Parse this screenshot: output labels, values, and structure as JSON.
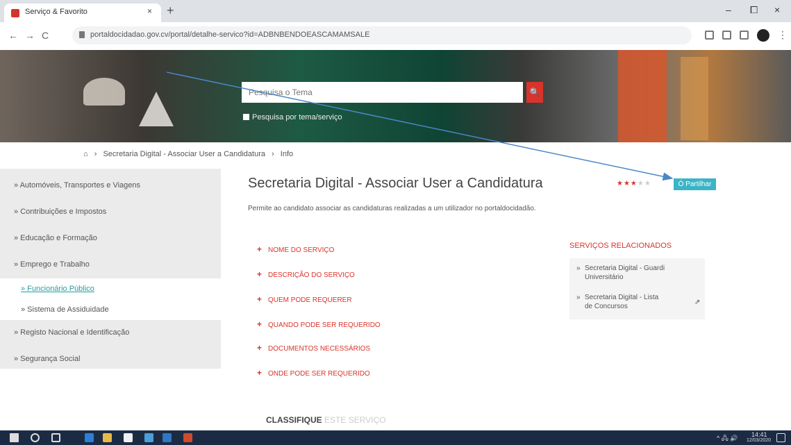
{
  "browser": {
    "tab_title": "Serviço & Favorito",
    "tab_close": "×",
    "new_tab": "+",
    "url": "portaldocidadao.gov.cv/portal/detalhe-servico?id=ADBNBENDOEASCAMAMSALE",
    "win_min": "–",
    "win_max": "⧠",
    "win_close": "×",
    "back": "←",
    "forward": "→",
    "reload": "C",
    "menu": "⋮"
  },
  "hero": {
    "search_placeholder": "Pesquisa o Tema",
    "search_button": "🔍",
    "checkbox_label": "Pesquisa por tema/serviço"
  },
  "breadcrumb": {
    "home": "⌂",
    "sep": "›",
    "crumb1": "Secretaria Digital - Associar User a Candidatura",
    "crumb2": "Info"
  },
  "sidebar": {
    "items": [
      {
        "label": "» Automóveis, Transportes e Viagens"
      },
      {
        "label": "» Contribuições e Impostos"
      },
      {
        "label": "» Educação e Formação"
      },
      {
        "label": "» Emprego e Trabalho"
      },
      {
        "label": "» Registo Nacional e Identificação"
      },
      {
        "label": "» Segurança Social"
      }
    ],
    "subitems": [
      {
        "label": "» Funcionário Público"
      },
      {
        "label": "» Sistema de Assiduidade"
      }
    ]
  },
  "main": {
    "title": "Secretaria Digital - Associar User a Candidatura",
    "stars_on": "★★★",
    "stars_off": "★★",
    "pill": "Ó Partilhar",
    "description": "Permite ao candidato associar as candidaturas realizadas a um utilizador no portaldocidadão.",
    "accordion": [
      {
        "label": "NOME DO SERVIÇO"
      },
      {
        "label": "DESCRIÇÃO DO SERVIÇO"
      },
      {
        "label": "QUEM PODE REQUERER"
      },
      {
        "label": "QUANDO PODE SER REQUERIDO"
      },
      {
        "label": "DOCUMENTOS NECESSÁRIOS"
      },
      {
        "label": "ONDE PODE SER REQUERIDO"
      }
    ],
    "plus": "+",
    "related_title": "SERVIÇOS RELACIONADOS",
    "related": [
      {
        "label": "Secretaria Digital - Guardi Universitário"
      },
      {
        "label": "Secretaria Digital - Lista de Concursos"
      }
    ],
    "related_bullet": "»",
    "ext_icon": "⇗",
    "classify": "CLASSIFIQUE",
    "classify_faint": "ESTE SERVIÇO"
  },
  "taskbar": {
    "time": "14:41",
    "date": "12/03/2020",
    "tray": "^ 🖧 🔊"
  },
  "colors": {
    "accent_red": "#d9342b",
    "accent_teal": "#3bb4c7",
    "arrow": "#4a86c8"
  }
}
